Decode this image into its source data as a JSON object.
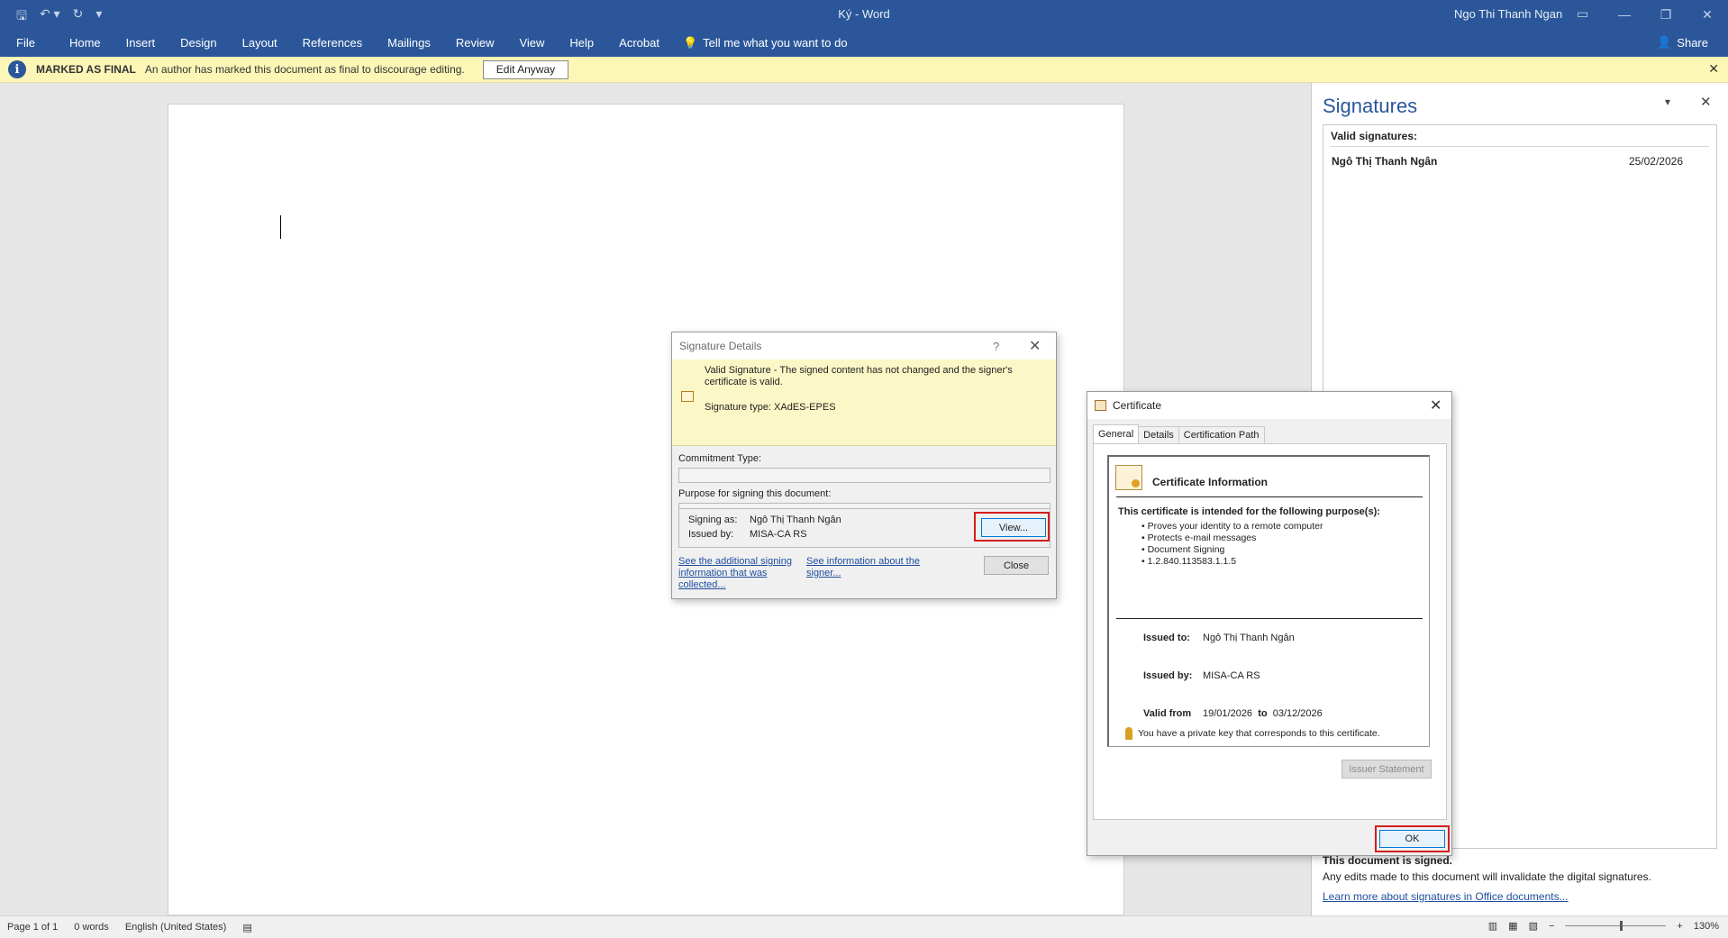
{
  "window": {
    "doc_title": "Ký  -  Word",
    "user": "Ngo Thi Thanh Ngan",
    "qat": {
      "save_icon": "save-icon",
      "undo_icon": "undo-icon",
      "redo_icon": "redo-icon",
      "customize_icon": "customize-qat-icon"
    }
  },
  "menu": {
    "tabs": [
      "File",
      "Home",
      "Insert",
      "Design",
      "Layout",
      "References",
      "Mailings",
      "Review",
      "View",
      "Help",
      "Acrobat"
    ],
    "tell_me": "Tell me what you want to do",
    "share": "Share"
  },
  "final_bar": {
    "label": "MARKED AS FINAL",
    "message": "An author has marked this document as final to discourage editing.",
    "button": "Edit Anyway"
  },
  "signatures_pane": {
    "title": "Signatures",
    "list_header": "Valid signatures:",
    "signer": "Ngô Thị Thanh Ngân",
    "date": "25/02/2026",
    "signed_title": "This document is signed.",
    "signed_message": "Any edits made to this document will invalidate the digital signatures.",
    "learn_more": "Learn more about signatures in Office documents..."
  },
  "status_bar": {
    "page": "Page 1 of 1",
    "words": "0 words",
    "language": "English (United States)",
    "zoom": "130%",
    "zoom_level": 0.55
  },
  "signature_details": {
    "title": "Signature Details",
    "help": "?",
    "valid_message": "Valid Signature - The signed content has not changed and the signer's certificate is valid.",
    "signature_type": "Signature type: XAdES-EPES",
    "commitment_label": "Commitment Type:",
    "commitment_value": "",
    "purpose_label": "Purpose for signing this document:",
    "purpose_value": "",
    "signing_as_label": "Signing as:",
    "signing_as_value": "Ngô Thị Thanh Ngân",
    "issued_by_label": "Issued by:",
    "issued_by_value": "MISA-CA RS",
    "view_button": "View...",
    "link_additional": "See the additional signing information that was collected...",
    "link_signer": "See information about the signer...",
    "close_button": "Close"
  },
  "certificate": {
    "title": "Certificate",
    "tabs": [
      "General",
      "Details",
      "Certification Path"
    ],
    "info_title": "Certificate Information",
    "purpose_title": "This certificate is intended for the following purpose(s):",
    "purposes": [
      "Proves your identity to a remote computer",
      "Protects e-mail messages",
      "Document Signing",
      "1.2.840.113583.1.1.5"
    ],
    "issued_to_label": "Issued to:",
    "issued_to_value": "Ngô Thị Thanh Ngân",
    "issued_by_label": "Issued by:",
    "issued_by_value": "MISA-CA RS",
    "valid_from_label": "Valid from",
    "valid_from_value": "19/01/2026",
    "valid_to_label": "to",
    "valid_to_value": "03/12/2026",
    "private_key_note": "You have a private key that corresponds to this certificate.",
    "issuer_statement_button": "Issuer Statement",
    "ok_button": "OK"
  },
  "colors": {
    "accent": "#2b579a",
    "final_bar": "#fcf7b6",
    "highlight_red": "#d31e1e",
    "link": "#1e4e9e"
  }
}
